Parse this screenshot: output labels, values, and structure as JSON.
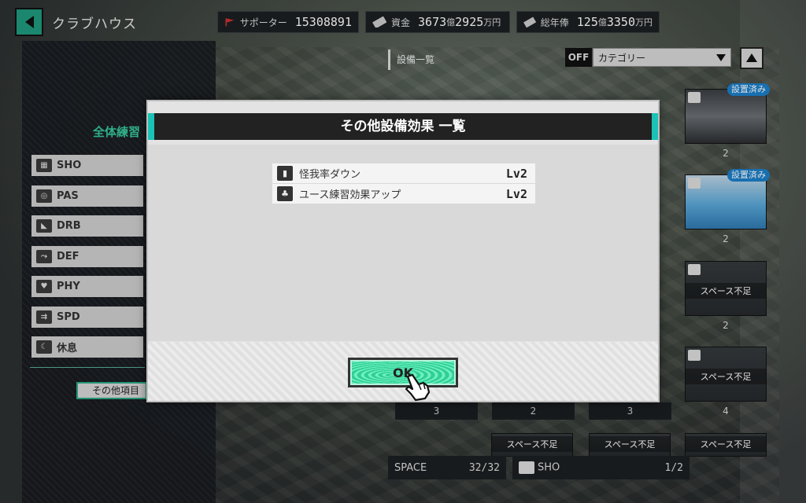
{
  "header": {
    "title": "クラブハウス",
    "supporters_label": "サポーター",
    "supporters_value": "15308891",
    "funds_label": "資金",
    "funds_oku": "3673",
    "funds_man": "2925",
    "total_salary_label": "総年俸",
    "total_salary_oku": "125",
    "total_salary_man": "3350",
    "unit_oku": "億",
    "unit_man": "万円"
  },
  "facility_list": {
    "title": "設備一覧",
    "filter_toggle": "OFF",
    "category_select": "カテゴリー",
    "installed_badge": "設置済み",
    "no_space_label": "スペース不足",
    "card_numbers": [
      "2",
      "2",
      "2",
      "4"
    ],
    "row_numbers": [
      "3",
      "2",
      "3"
    ]
  },
  "sidebar": {
    "heading": "全体練習",
    "items": [
      {
        "label": "SHO"
      },
      {
        "label": "PAS"
      },
      {
        "label": "DRB"
      },
      {
        "label": "DEF"
      },
      {
        "label": "PHY"
      },
      {
        "label": "SPD"
      },
      {
        "label": "休息"
      }
    ],
    "other_items": "その他項目"
  },
  "footer": {
    "space_label": "SPACE",
    "space_value": "32/32",
    "sho_label": "SHO",
    "sho_value": "1/2"
  },
  "modal": {
    "title": "その他設備効果 一覧",
    "effects": [
      {
        "name": "怪我率ダウン",
        "level": "Lv2",
        "icon": "injury-spray-icon"
      },
      {
        "name": "ユース練習効果アップ",
        "level": "Lv2",
        "icon": "youth-sprout-icon"
      }
    ],
    "ok_label": "OK"
  },
  "colors": {
    "accent_green": "#36c79a",
    "modal_header_accent": "#1bc2b6",
    "badge_blue": "#1c7fc9"
  }
}
